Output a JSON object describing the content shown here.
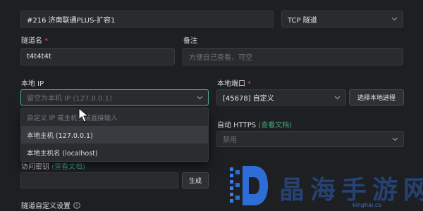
{
  "node_field": {
    "value": "#216 济南联通PLUS-扩容1"
  },
  "protocol_select": {
    "value": "TCP 隧道"
  },
  "tunnel_name": {
    "label": "隧道名",
    "required_mark": "*",
    "value": "t4t4t4t"
  },
  "remark": {
    "label": "备注",
    "placeholder": "方便自己查看，可空"
  },
  "local_ip": {
    "label": "本地 IP",
    "placeholder": "留空为本机 IP (127.0.0.1)",
    "dropdown_options": [
      "自定义 IP 或主机名请直接输入",
      "本地主机 (127.0.0.1)",
      "本地主机名 (localhost)"
    ]
  },
  "local_port": {
    "label": "本地端口",
    "required_mark": "*",
    "value": "[45678] 自定义",
    "pick_button": "选择本地进程"
  },
  "auto_https": {
    "label": "自动 HTTPS",
    "help_link": "(查看文档)",
    "value": "禁用"
  },
  "access_key": {
    "label": "访问密钥",
    "help_link": "(查看文档)",
    "generate_button": "生成"
  },
  "custom_settings": {
    "label": "隧道自定义设置"
  },
  "watermark": {
    "text": "晶海手游网",
    "subtext": "kinghai.co"
  },
  "colors": {
    "accent": "#4fb686",
    "required": "#e05a5a",
    "watermark": "#2f6dd6"
  }
}
